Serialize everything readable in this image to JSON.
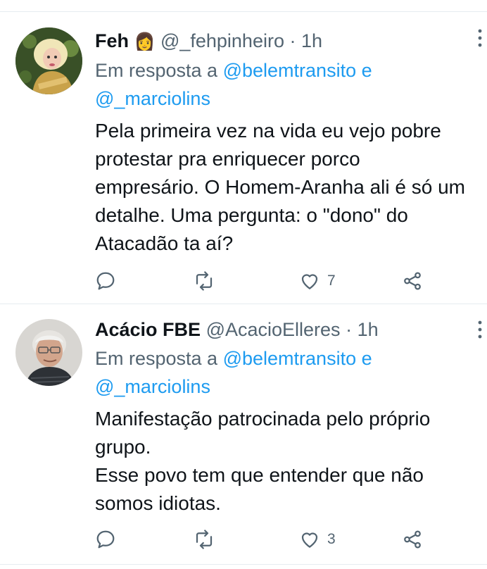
{
  "tweets": [
    {
      "name": "Feh",
      "emoji": "👩",
      "handle": "@_fehpinheiro",
      "separator": "·",
      "time": "1h",
      "reply_prefix": "Em resposta a",
      "reply_mention_1": "@belemtransito",
      "reply_and": "e",
      "reply_mention_2": "@_marciolins",
      "text": "Pela primeira vez na vida eu vejo pobre\nprotestar pra enriquecer porco\nempresário. O Homem-Aranha ali é só um\ndetalhe. Uma pergunta: o \"dono\" do\nAtacadão ta aí?",
      "likes": "7",
      "avatar_icon": "profile-photo-blonde-woman"
    },
    {
      "name": "Acácio FBE",
      "handle": "@AcacioElleres",
      "separator": "·",
      "time": "1h",
      "reply_prefix": "Em resposta a",
      "reply_mention_1": "@belemtransito",
      "reply_and": "e",
      "reply_mention_2": "@_marciolins",
      "text": "Manifestação patrocinada pelo próprio\ngrupo.\nEsse povo tem que entender que não\nsomos idiotas.",
      "likes": "3",
      "avatar_icon": "profile-photo-older-man-glasses"
    }
  ],
  "icons": {
    "reply": "reply-icon",
    "retweet": "retweet-icon",
    "like": "heart-icon",
    "share": "share-icon",
    "more": "more-vertical-icon"
  },
  "colors": {
    "text": "#0f1419",
    "secondary": "#536471",
    "link": "#1d9bf0",
    "divider": "#e6ecf0"
  }
}
